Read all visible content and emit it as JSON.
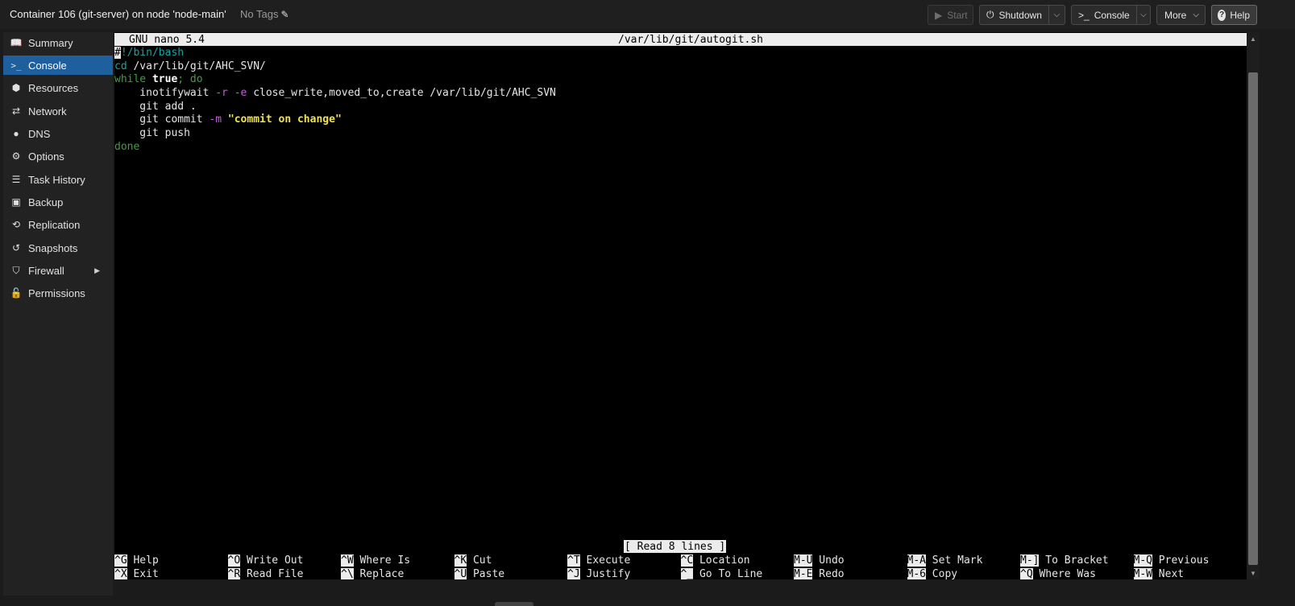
{
  "header": {
    "title": "Container 106 (git-server) on node 'node-main'",
    "tags_label": "No Tags",
    "buttons": {
      "start": "Start",
      "shutdown": "Shutdown",
      "console": "Console",
      "more": "More",
      "help": "Help"
    }
  },
  "sidebar": {
    "items": [
      {
        "label": "Summary",
        "icon": "book-icon"
      },
      {
        "label": "Console",
        "icon": "terminal-icon"
      },
      {
        "label": "Resources",
        "icon": "cube-icon"
      },
      {
        "label": "Network",
        "icon": "exchange-icon"
      },
      {
        "label": "DNS",
        "icon": "globe-icon"
      },
      {
        "label": "Options",
        "icon": "gear-icon"
      },
      {
        "label": "Task History",
        "icon": "list-icon"
      },
      {
        "label": "Backup",
        "icon": "floppy-icon"
      },
      {
        "label": "Replication",
        "icon": "retweet-icon"
      },
      {
        "label": "Snapshots",
        "icon": "history-icon"
      },
      {
        "label": "Firewall",
        "icon": "shield-icon"
      },
      {
        "label": "Permissions",
        "icon": "unlock-icon"
      }
    ],
    "active": "Console"
  },
  "terminal": {
    "nano_version": "GNU nano 5.4",
    "file_path": "/var/lib/git/autogit.sh",
    "lines": {
      "l1_cursor": "#",
      "l1_rest": "!/bin/bash",
      "l2_cmd": "cd",
      "l2_rest": " /var/lib/git/AHC_SVN/",
      "l3_kw1": "while",
      "l3_true": " true",
      "l3_kw2": "; do",
      "l4_cmd": "    inotifywait ",
      "l4_flag1": "-r",
      "l4_flag2": "-e",
      "l4_rest": " close_write,moved_to,create /var/lib/git/AHC_SVN",
      "l5": "    git add .",
      "l6_cmd": "    git commit ",
      "l6_flag": "-m",
      "l6_str": "\"commit on change\"",
      "l7": "    git push",
      "l8": "done"
    },
    "status_message": "[ Read 8 lines ]",
    "shortcuts_row1": [
      {
        "key": "^G",
        "label": " Help"
      },
      {
        "key": "^O",
        "label": " Write Out"
      },
      {
        "key": "^W",
        "label": " Where Is"
      },
      {
        "key": "^K",
        "label": " Cut"
      },
      {
        "key": "^T",
        "label": " Execute"
      },
      {
        "key": "^C",
        "label": " Location"
      },
      {
        "key": "M-U",
        "label": " Undo"
      },
      {
        "key": "M-A",
        "label": " Set Mark"
      },
      {
        "key": "M-]",
        "label": " To Bracket"
      },
      {
        "key": "M-Q",
        "label": " Previous"
      }
    ],
    "shortcuts_row2": [
      {
        "key": "^X",
        "label": " Exit"
      },
      {
        "key": "^R",
        "label": " Read File"
      },
      {
        "key": "^\\",
        "label": " Replace"
      },
      {
        "key": "^U",
        "label": " Paste"
      },
      {
        "key": "^J",
        "label": " Justify"
      },
      {
        "key": "^_",
        "label": " Go To Line"
      },
      {
        "key": "M-E",
        "label": " Redo"
      },
      {
        "key": "M-6",
        "label": " Copy"
      },
      {
        "key": "^Q",
        "label": " Where Was"
      },
      {
        "key": "M-W",
        "label": " Next"
      }
    ]
  },
  "colors": {
    "active_nav": "#1e5f9e",
    "comment": "#1aa3a3",
    "keyword": "#3aa33a",
    "flag": "#c25ed8",
    "string": "#f0e24a"
  }
}
